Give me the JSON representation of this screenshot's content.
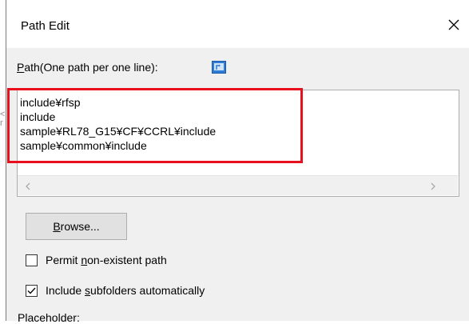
{
  "dialog": {
    "title": "Path Edit",
    "close_icon": "close-icon"
  },
  "path": {
    "label_underlined": "P",
    "label_rest": "ath(One path per one line):",
    "browse_icon": "folder-browse-icon",
    "lines": [
      "include¥rfsp",
      "include",
      "sample¥RL78_G15¥CF¥CCRL¥include",
      "sample¥common¥include"
    ],
    "highlight_color": "#e8101c"
  },
  "browse_button": {
    "underlined": "B",
    "rest": "rowse..."
  },
  "options": {
    "permit_before": "Permit ",
    "permit_underlined": "n",
    "permit_after": "on-existent path",
    "permit_checked": false,
    "include_before": "Include ",
    "include_underlined": "s",
    "include_after": "ubfolders automatically",
    "include_checked": true
  },
  "placeholder": {
    "label": "Placeholder:"
  }
}
